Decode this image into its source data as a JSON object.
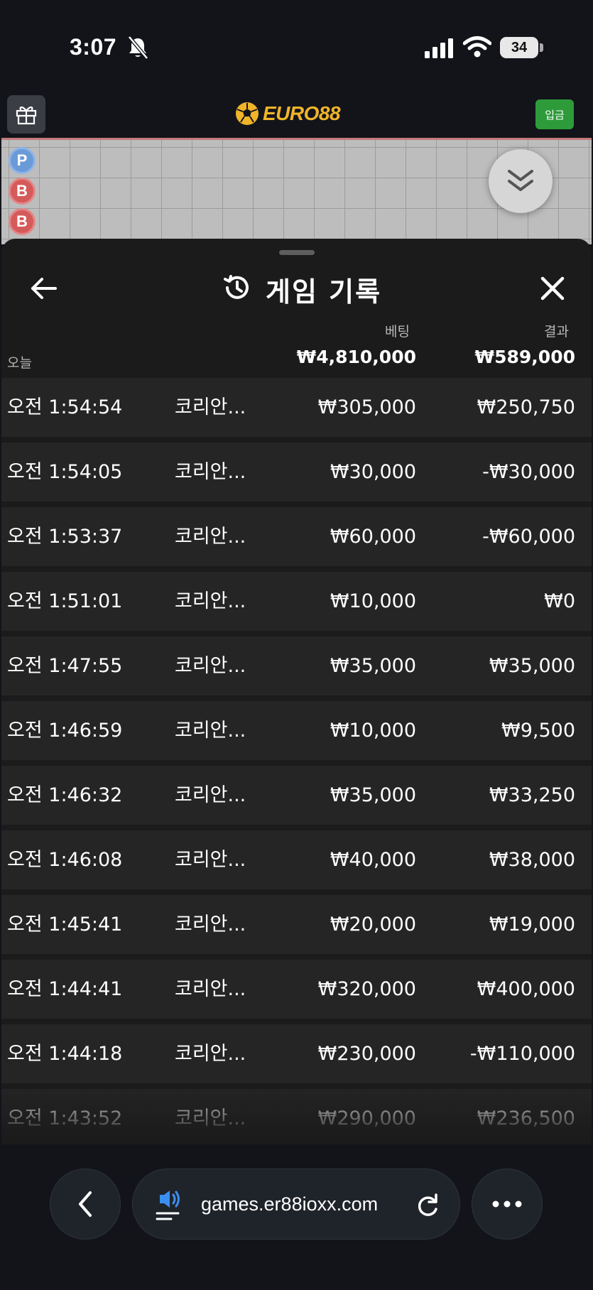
{
  "status_bar": {
    "time": "3:07",
    "battery": "34"
  },
  "header": {
    "logo_text": "EURO88",
    "deposit_label": "입금"
  },
  "roadmap": {
    "dots": [
      "P",
      "B",
      "B"
    ]
  },
  "sheet": {
    "title": "게임 기록",
    "col_bet": "베팅",
    "col_result": "결과",
    "today_label": "오늘",
    "total_bet": "₩4,810,000",
    "total_result": "₩589,000",
    "rows": [
      {
        "time": "오전 1:54:54",
        "game": "코리안...",
        "bet": "₩305,000",
        "result": "₩250,750"
      },
      {
        "time": "오전 1:54:05",
        "game": "코리안...",
        "bet": "₩30,000",
        "result": "-₩30,000"
      },
      {
        "time": "오전 1:53:37",
        "game": "코리안...",
        "bet": "₩60,000",
        "result": "-₩60,000"
      },
      {
        "time": "오전 1:51:01",
        "game": "코리안...",
        "bet": "₩10,000",
        "result": "₩0"
      },
      {
        "time": "오전 1:47:55",
        "game": "코리안...",
        "bet": "₩35,000",
        "result": "₩35,000"
      },
      {
        "time": "오전 1:46:59",
        "game": "코리안...",
        "bet": "₩10,000",
        "result": "₩9,500"
      },
      {
        "time": "오전 1:46:32",
        "game": "코리안...",
        "bet": "₩35,000",
        "result": "₩33,250"
      },
      {
        "time": "오전 1:46:08",
        "game": "코리안...",
        "bet": "₩40,000",
        "result": "₩38,000"
      },
      {
        "time": "오전 1:45:41",
        "game": "코리안...",
        "bet": "₩20,000",
        "result": "₩19,000"
      },
      {
        "time": "오전 1:44:41",
        "game": "코리안...",
        "bet": "₩320,000",
        "result": "₩400,000"
      },
      {
        "time": "오전 1:44:18",
        "game": "코리안...",
        "bet": "₩230,000",
        "result": "-₩110,000"
      },
      {
        "time": "오전 1:43:52",
        "game": "코리안...",
        "bet": "₩290,000",
        "result": "₩236,500"
      }
    ]
  },
  "browser": {
    "url": "games.er88ioxx.com"
  },
  "colors": {
    "background": "#12141a",
    "sheet": "#1b1b1c",
    "row": "#252525",
    "brand": "#f0b429",
    "deposit": "#2e9b3a"
  }
}
